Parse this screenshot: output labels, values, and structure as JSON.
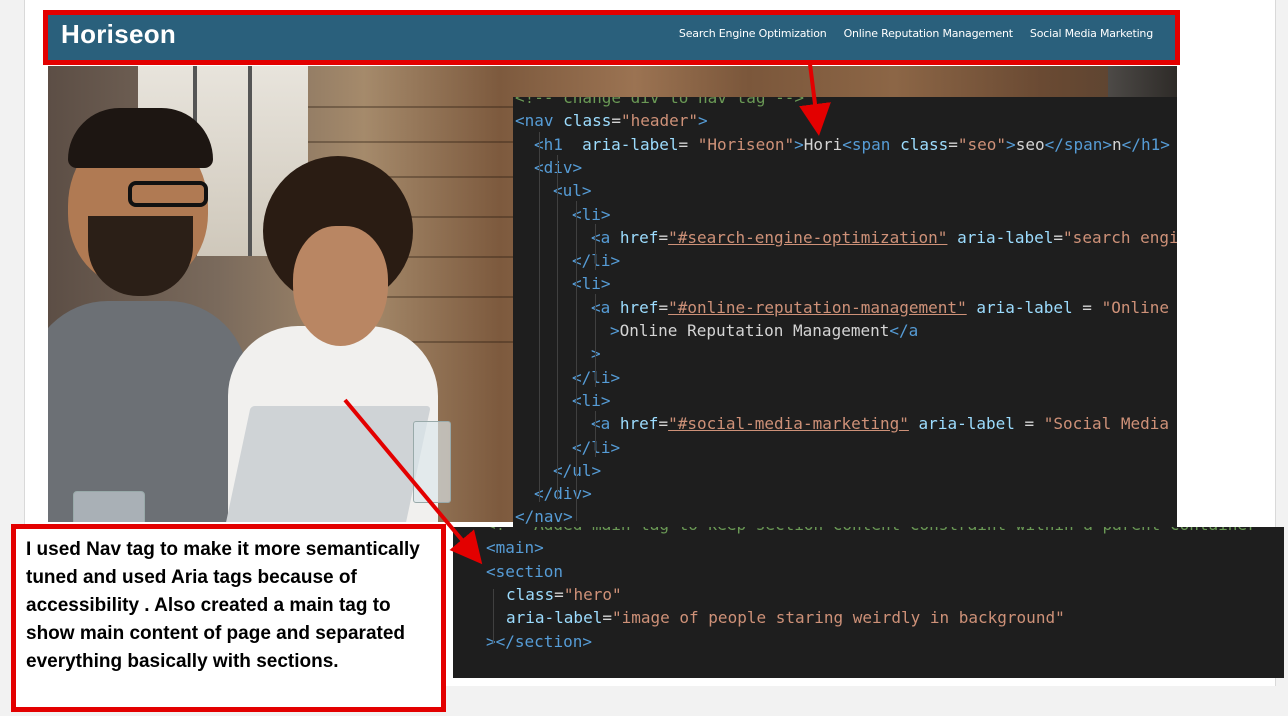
{
  "site": {
    "logo": "Horiseon",
    "nav": [
      "Search Engine Optimization",
      "Online Reputation Management",
      "Social Media Marketing"
    ]
  },
  "code_top": [
    {
      "indent": 0,
      "tokens": [
        [
          "cmt",
          "<!-- change div to nav tag -->"
        ]
      ]
    },
    {
      "indent": 0,
      "tokens": [
        [
          "tag",
          "<nav "
        ],
        [
          "attr",
          "class"
        ],
        [
          "txt",
          "="
        ],
        [
          "str",
          "\"header\""
        ],
        [
          "tag",
          ">"
        ]
      ]
    },
    {
      "indent": 1,
      "tokens": [
        [
          "tag",
          "<h1  "
        ],
        [
          "attr",
          "aria-label"
        ],
        [
          "txt",
          "= "
        ],
        [
          "str",
          "\"Horiseon\""
        ],
        [
          "tag",
          ">"
        ],
        [
          "txt",
          "Hori"
        ],
        [
          "tag",
          "<span "
        ],
        [
          "attr",
          "class"
        ],
        [
          "txt",
          "="
        ],
        [
          "str",
          "\"seo\""
        ],
        [
          "tag",
          ">"
        ],
        [
          "txt",
          "seo"
        ],
        [
          "tag",
          "</span>"
        ],
        [
          "txt",
          "n"
        ],
        [
          "tag",
          "</h1>"
        ]
      ]
    },
    {
      "indent": 1,
      "tokens": [
        [
          "tag",
          "<div>"
        ]
      ]
    },
    {
      "indent": 2,
      "tokens": [
        [
          "tag",
          "<ul>"
        ]
      ]
    },
    {
      "indent": 3,
      "tokens": [
        [
          "tag",
          "<li>"
        ]
      ]
    },
    {
      "indent": 4,
      "tokens": [
        [
          "tag",
          "<a "
        ],
        [
          "attr",
          "href"
        ],
        [
          "txt",
          "="
        ],
        [
          "href",
          "\"#search-engine-optimization\""
        ],
        [
          "txt",
          " "
        ],
        [
          "attr",
          "aria-label"
        ],
        [
          "txt",
          "="
        ],
        [
          "str",
          "\"search engine optimization\""
        ]
      ]
    },
    {
      "indent": 3,
      "tokens": [
        [
          "tag",
          "</li>"
        ]
      ]
    },
    {
      "indent": 3,
      "tokens": [
        [
          "tag",
          "<li>"
        ]
      ]
    },
    {
      "indent": 4,
      "tokens": [
        [
          "tag",
          "<a "
        ],
        [
          "attr",
          "href"
        ],
        [
          "txt",
          "="
        ],
        [
          "href",
          "\"#online-reputation-management\""
        ],
        [
          "txt",
          " "
        ],
        [
          "attr",
          "aria-label"
        ],
        [
          "txt",
          " = "
        ],
        [
          "str",
          "\"Online Reputation\""
        ]
      ]
    },
    {
      "indent": 5,
      "tokens": [
        [
          "tag",
          ">"
        ],
        [
          "txt",
          "Online Reputation Management"
        ],
        [
          "tag",
          "</a"
        ]
      ]
    },
    {
      "indent": 4,
      "tokens": [
        [
          "tag",
          ">"
        ]
      ]
    },
    {
      "indent": 3,
      "tokens": [
        [
          "tag",
          "</li>"
        ]
      ]
    },
    {
      "indent": 3,
      "tokens": [
        [
          "tag",
          "<li>"
        ]
      ]
    },
    {
      "indent": 4,
      "tokens": [
        [
          "tag",
          "<a "
        ],
        [
          "attr",
          "href"
        ],
        [
          "txt",
          "="
        ],
        [
          "href",
          "\"#social-media-marketing\""
        ],
        [
          "txt",
          " "
        ],
        [
          "attr",
          "aria-label"
        ],
        [
          "txt",
          " = "
        ],
        [
          "str",
          "\"Social Media Marketing\""
        ]
      ]
    },
    {
      "indent": 3,
      "tokens": [
        [
          "tag",
          "</li>"
        ]
      ]
    },
    {
      "indent": 2,
      "tokens": [
        [
          "tag",
          "</ul>"
        ]
      ]
    },
    {
      "indent": 1,
      "tokens": [
        [
          "tag",
          "</div>"
        ]
      ]
    },
    {
      "indent": 0,
      "tokens": [
        [
          "tag",
          "</nav>"
        ]
      ]
    }
  ],
  "code_bottom": [
    {
      "indent": 0,
      "tokens": [
        [
          "cmt",
          "<!-- Added main tag to keep section content constraint within a parent container -->"
        ]
      ]
    },
    {
      "indent": 0,
      "tokens": [
        [
          "tag",
          "<main>"
        ]
      ]
    },
    {
      "indent": 0,
      "tokens": [
        [
          "tag",
          "<section"
        ]
      ]
    },
    {
      "indent": 1,
      "tokens": [
        [
          "attr",
          "class"
        ],
        [
          "txt",
          "="
        ],
        [
          "str",
          "\"hero\""
        ]
      ]
    },
    {
      "indent": 1,
      "tokens": [
        [
          "attr",
          "aria-label"
        ],
        [
          "txt",
          "="
        ],
        [
          "str",
          "\"image of people staring weirdly in background\""
        ]
      ]
    },
    {
      "indent": 0,
      "tokens": [
        [
          "tag",
          ">"
        ],
        [
          "tag",
          "</section>"
        ]
      ]
    }
  ],
  "note": "I used Nav tag to make it more semantically tuned and used Aria tags because of accessibility . Also created a main tag to show main content of page and separated everything basically with sections.",
  "colors": {
    "header_bg": "#2a607c",
    "annotation_red": "#e30000",
    "editor_bg": "#1e1e1e"
  }
}
